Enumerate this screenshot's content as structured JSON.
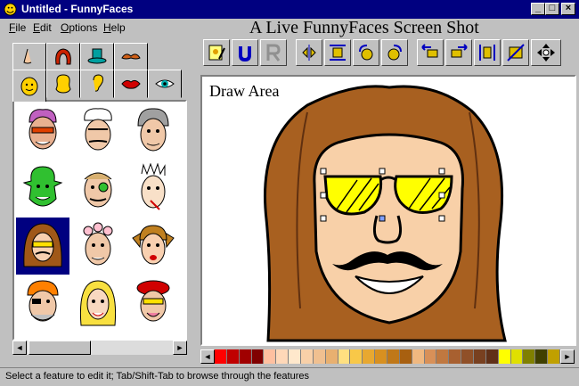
{
  "window": {
    "title": "Untitled - FunnyFaces",
    "minimize_glyph": "_",
    "maximize_glyph": "□",
    "close_glyph": "×"
  },
  "menu": {
    "items": [
      {
        "label": "File",
        "key": "F",
        "rest": "ile"
      },
      {
        "label": "Edit",
        "key": "E",
        "rest": "dit"
      },
      {
        "label": "Options",
        "key": "O",
        "rest": "ptions"
      },
      {
        "label": "Help",
        "key": "H",
        "rest": "elp"
      }
    ]
  },
  "heading": "A Live FunnyFaces Screen Shot",
  "feature_tabs": {
    "row1": [
      "nose-icon",
      "hair-icon",
      "hat-icon",
      "mustache-icon"
    ],
    "row2": [
      "face-icon",
      "head-shape-icon",
      "ear-icon",
      "lips-icon",
      "eye-icon"
    ],
    "active": "face-icon"
  },
  "toolbar": {
    "buttons": [
      "edit-icon",
      "undo-icon",
      "redo-icon",
      "flip-horizontal-icon",
      "stretch-icon",
      "rotate-left-icon",
      "rotate-right-icon",
      "move-left-icon",
      "move-right-icon",
      "shrink-icon",
      "enlarge-icon",
      "move-arrows-icon"
    ]
  },
  "draw_area": {
    "label": "Draw Area"
  },
  "palette": {
    "left_arrow": "◄",
    "right_arrow": "►",
    "colors": [
      "#ff0000",
      "#c00000",
      "#a00000",
      "#800000",
      "#ffc0a0",
      "#ffd8b8",
      "#ffe8cc",
      "#f8d0a8",
      "#f0c090",
      "#e8b070",
      "#ffe080",
      "#f8c848",
      "#e8a830",
      "#d89020",
      "#c07818",
      "#a86010",
      "#f0b880",
      "#d89058",
      "#c07840",
      "#a86030",
      "#905028",
      "#784020",
      "#603018",
      "#ffff00",
      "#e0e000",
      "#808000",
      "#404000",
      "#c0a000"
    ]
  },
  "left_scroll": {
    "left_arrow": "◄",
    "right_arrow": "►"
  },
  "status": {
    "text": "Select a feature to edit it; Tab/Shift-Tab to browse through the features"
  }
}
